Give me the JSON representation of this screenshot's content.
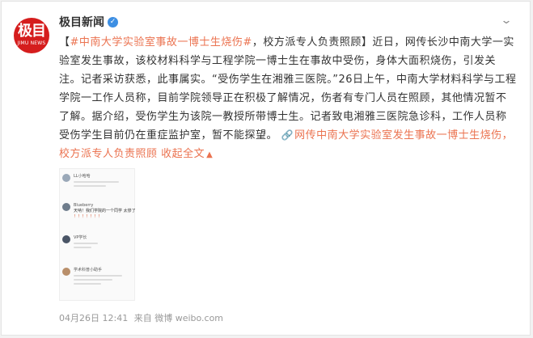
{
  "account": {
    "name": "极目新闻",
    "avatar_mark": "极目",
    "avatar_sub": "JIMU NEWS",
    "verified_icon": "verified-badge-icon",
    "menu_icon": "chevron-down-icon"
  },
  "post": {
    "text_open": "【",
    "hashtag": "#中南大学实验室事故一博士生烧伤#",
    "text_main": "，校方派专人负责照顾】近日，网传长沙中南大学一实验室发生事故，该校材料科学与工程学院一博士生在事故中受伤，身体大面积烧伤，引发关注。记者采访获悉，此事属实。“受伤学生在湘雅三医院。”26日上午，中南大学材料科学与工程学院一工作人员称，目前学院领导正在积极了解情况，伤者有专门人员在照顾，其他情况暂不了解。据介绍，受伤学生为该院一教授所带博士生。记者致电湘雅三医院急诊科，工作人员称受伤学生目前仍在重症监护室，暂不能探望。",
    "topic_link": "网传中南大学实验室发生事故一博士生烧伤，校方派专人负责照顾",
    "link_icon": "link-icon",
    "expand_label": "收起全文",
    "expand_icon": "chevron-up-icon"
  },
  "screenshot": {
    "comments": [
      {
        "name": "LL小哈哈",
        "text": ""
      },
      {
        "name": "Blueberry",
        "text": "天呐！我们学院的一个同学 太惨了",
        "extra": "！！！！！！！"
      },
      {
        "name": "VP学长",
        "text": ""
      },
      {
        "name": "学术科普小助手",
        "text": ""
      }
    ]
  },
  "meta": {
    "date": "04月26日 12:41",
    "source": "来自 微博 weibo.com"
  },
  "colors": {
    "accent": "#eb7350",
    "brand_red": "#d51d1d",
    "verified_blue": "#3d8fe3"
  }
}
